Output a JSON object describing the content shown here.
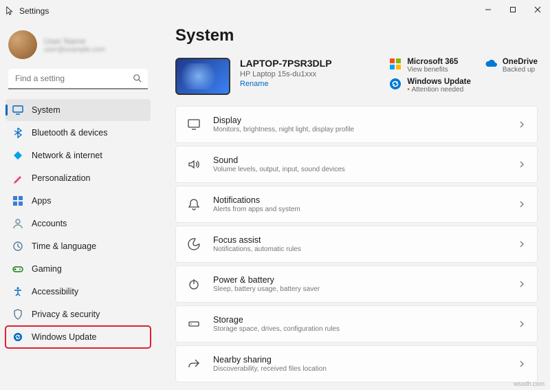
{
  "window": {
    "title": "Settings"
  },
  "profile": {
    "name": "User Name",
    "email": "user@example.com"
  },
  "search": {
    "placeholder": "Find a setting"
  },
  "sidebar": {
    "items": [
      {
        "label": "System",
        "icon": "system",
        "color": "#0067c0",
        "active": true
      },
      {
        "label": "Bluetooth & devices",
        "icon": "bluetooth",
        "color": "#0067c0"
      },
      {
        "label": "Network & internet",
        "icon": "network",
        "color": "#00a2ed"
      },
      {
        "label": "Personalization",
        "icon": "personalization",
        "color": "#e8467c"
      },
      {
        "label": "Apps",
        "icon": "apps",
        "color": "#3b7dd8"
      },
      {
        "label": "Accounts",
        "icon": "accounts",
        "color": "#6b8e9e"
      },
      {
        "label": "Time & language",
        "icon": "time",
        "color": "#5b7c99"
      },
      {
        "label": "Gaming",
        "icon": "gaming",
        "color": "#107c10"
      },
      {
        "label": "Accessibility",
        "icon": "accessibility",
        "color": "#0067c0"
      },
      {
        "label": "Privacy & security",
        "icon": "privacy",
        "color": "#5b7c99"
      },
      {
        "label": "Windows Update",
        "icon": "update",
        "color": "#0067c0",
        "highlighted": true
      }
    ]
  },
  "main": {
    "heading": "System",
    "device": {
      "name": "LAPTOP-7PSR3DLP",
      "model": "HP Laptop 15s-du1xxx",
      "rename": "Rename"
    },
    "promos": [
      {
        "title": "Microsoft 365",
        "sub": "View benefits",
        "icon": "ms365"
      },
      {
        "title": "OneDrive",
        "sub": "Backed up",
        "icon": "onedrive"
      },
      {
        "title": "Windows Update",
        "sub": "Attention needed",
        "icon": "update",
        "warn": true
      }
    ],
    "cards": [
      {
        "title": "Display",
        "sub": "Monitors, brightness, night light, display profile",
        "icon": "display"
      },
      {
        "title": "Sound",
        "sub": "Volume levels, output, input, sound devices",
        "icon": "sound"
      },
      {
        "title": "Notifications",
        "sub": "Alerts from apps and system",
        "icon": "notifications"
      },
      {
        "title": "Focus assist",
        "sub": "Notifications, automatic rules",
        "icon": "focus"
      },
      {
        "title": "Power & battery",
        "sub": "Sleep, battery usage, battery saver",
        "icon": "power"
      },
      {
        "title": "Storage",
        "sub": "Storage space, drives, configuration rules",
        "icon": "storage"
      },
      {
        "title": "Nearby sharing",
        "sub": "Discoverability, received files location",
        "icon": "share"
      }
    ]
  },
  "watermark": "wsxdh.com"
}
